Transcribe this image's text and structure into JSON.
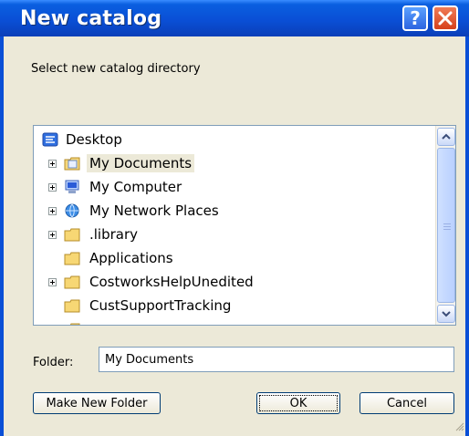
{
  "window": {
    "title": "New catalog",
    "help_glyph": "?",
    "close_glyph": "×"
  },
  "prompt": "Select new catalog directory",
  "tree": {
    "items": [
      {
        "label": "Desktop",
        "icon": "desktop-icon",
        "expandable": false
      },
      {
        "label": "My Documents",
        "icon": "my-documents-icon",
        "expandable": true,
        "selected": true
      },
      {
        "label": "My Computer",
        "icon": "my-computer-icon",
        "expandable": true
      },
      {
        "label": "My Network Places",
        "icon": "network-places-icon",
        "expandable": true
      },
      {
        "label": ".library",
        "icon": "folder-icon",
        "expandable": true
      },
      {
        "label": "Applications",
        "icon": "folder-icon",
        "expandable": false
      },
      {
        "label": "CostworksHelpUnedited",
        "icon": "folder-icon",
        "expandable": true
      },
      {
        "label": "CustSupportTracking",
        "icon": "folder-icon",
        "expandable": false
      }
    ]
  },
  "folder": {
    "label": "Folder:",
    "value": "My Documents"
  },
  "buttons": {
    "make_new_folder": "Make New Folder",
    "ok": "OK",
    "cancel": "Cancel"
  },
  "colors": {
    "titlebar": "#0A4FD6",
    "dialog_bg": "#ECE9D8",
    "close_red": "#D6401B"
  }
}
